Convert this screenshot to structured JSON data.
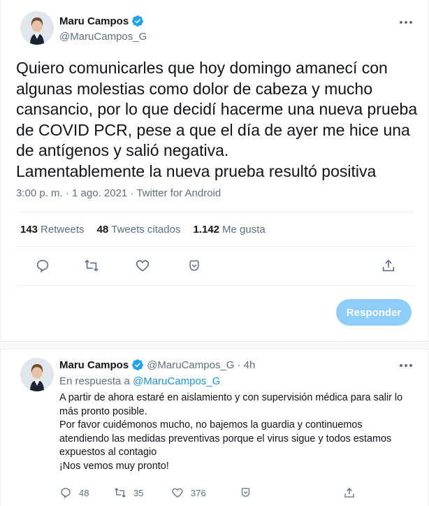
{
  "main_tweet": {
    "author_name": "Maru Campos",
    "author_handle": "@MaruCampos_G",
    "text": "Quiero comunicarles que hoy domingo amanecí con\nalgunas molestias como dolor de cabeza y mucho\ncansancio, por lo que decidí hacerme una nueva prueba\nde COVID PCR, pese a que el día de ayer me hice una\nde antígenos y salió negativa.\nLamentablemente la nueva prueba resultó positiva",
    "timestamp": "3:00 p. m. · 1 ago. 2021 · Twitter for Android",
    "stats": {
      "retweets_count": "143",
      "retweets_label": "Retweets",
      "quotes_count": "48",
      "quotes_label": "Tweets citados",
      "likes_count": "1.142",
      "likes_label": "Me gusta"
    },
    "reply_button_label": "Responder"
  },
  "reply_tweet": {
    "author_name": "Maru Campos",
    "author_handle": "@MaruCampos_G",
    "time_ago": "· 4h",
    "in_reply_prefix": "En respuesta a",
    "in_reply_handle": "@MaruCampos_G",
    "paragraphs": [
      "A partir de ahora estaré en aislamiento y con supervisión médica para salir lo más pronto posible.",
      "Por favor cuidémonos mucho, no bajemos la guardia y continuemos atendiendo las medidas preventivas porque el virus sigue y todos estamos expuestos al contagio",
      "¡Nos vemos muy pronto!"
    ],
    "counts": {
      "replies": "48",
      "retweets": "35",
      "likes": "376"
    }
  },
  "colors": {
    "accent": "#1da1f2",
    "secondary_text": "#5b7083",
    "reply_button": "#8ecdf8",
    "divider": "#ebeef0"
  },
  "icons": [
    "verified-badge-icon",
    "more-options-icon",
    "reply-icon",
    "retweet-icon",
    "like-icon",
    "bookmark-icon",
    "share-icon"
  ]
}
